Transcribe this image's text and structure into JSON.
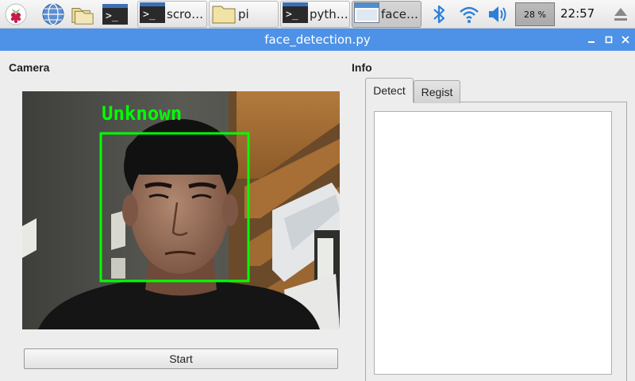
{
  "taskbar": {
    "launchers": [
      {
        "icon": "raspberry-icon"
      },
      {
        "icon": "globe-icon"
      },
      {
        "icon": "folders-icon"
      },
      {
        "icon": "terminal-icon"
      }
    ],
    "tasks": [
      {
        "label": "scro…",
        "icon": "terminal-icon"
      },
      {
        "label": "pi",
        "icon": "folder-icon"
      },
      {
        "label": "pyth…",
        "icon": "terminal-icon"
      },
      {
        "label": "face…",
        "icon": "window-icon",
        "active": true
      }
    ],
    "terminal_glyph": ">_",
    "cpu_label": "28 %",
    "clock": "22:57"
  },
  "window": {
    "title": "face_detection.py"
  },
  "camera": {
    "group_label": "Camera",
    "detection_label": "Unknown",
    "box_color": "#00ff00",
    "start_button": "Start"
  },
  "info": {
    "group_label": "Info",
    "tabs": [
      {
        "label": "Detect",
        "active": true
      },
      {
        "label": "Regist",
        "active": false
      }
    ],
    "text": ""
  },
  "colors": {
    "titlebar": "#4d92e7",
    "accent": "#3d6fb6"
  }
}
